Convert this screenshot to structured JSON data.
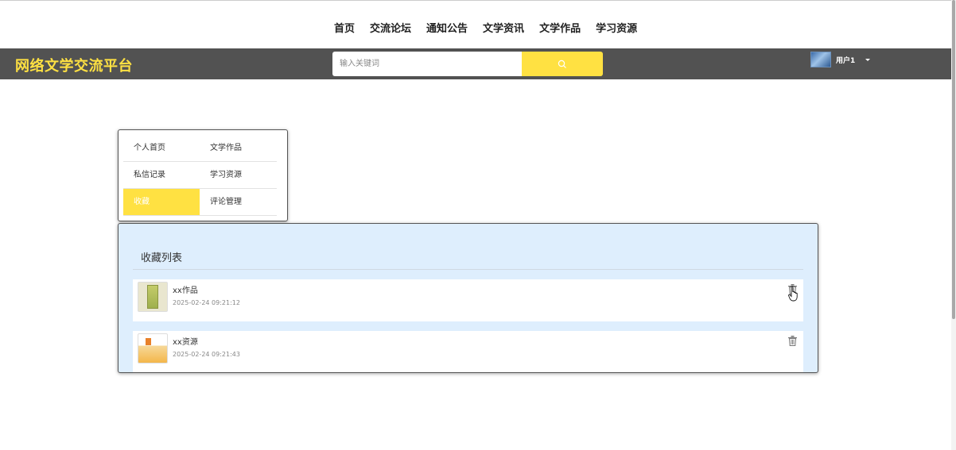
{
  "nav": {
    "links": [
      "首页",
      "交流论坛",
      "通知公告",
      "文学资讯",
      "文学作品",
      "学习资源"
    ]
  },
  "header": {
    "brand": "网络文学交流平台",
    "search_placeholder": "输入关键词",
    "user_name": "用户1"
  },
  "sidebar_menu": {
    "items": [
      {
        "label": "个人首页",
        "active": false
      },
      {
        "label": "文学作品",
        "active": false
      },
      {
        "label": "私信记录",
        "active": false
      },
      {
        "label": "学习资源",
        "active": false
      },
      {
        "label": "收藏",
        "active": true
      },
      {
        "label": "评论管理",
        "active": false
      }
    ]
  },
  "favorites": {
    "title": "收藏列表",
    "items": [
      {
        "name": "xx作品",
        "date": "2025-02-24 09:21:12",
        "thumbnail": "book-cover"
      },
      {
        "name": "xx资源",
        "date": "2025-02-24 09:21:43",
        "thumbnail": "resource-cover"
      }
    ]
  },
  "colors": {
    "accent": "#ffe142",
    "header_bg": "#525252",
    "panel_bg": "#deeefd"
  },
  "icons": {
    "search": "search-icon",
    "delete": "trash-icon",
    "dropdown": "caret-down-icon"
  }
}
